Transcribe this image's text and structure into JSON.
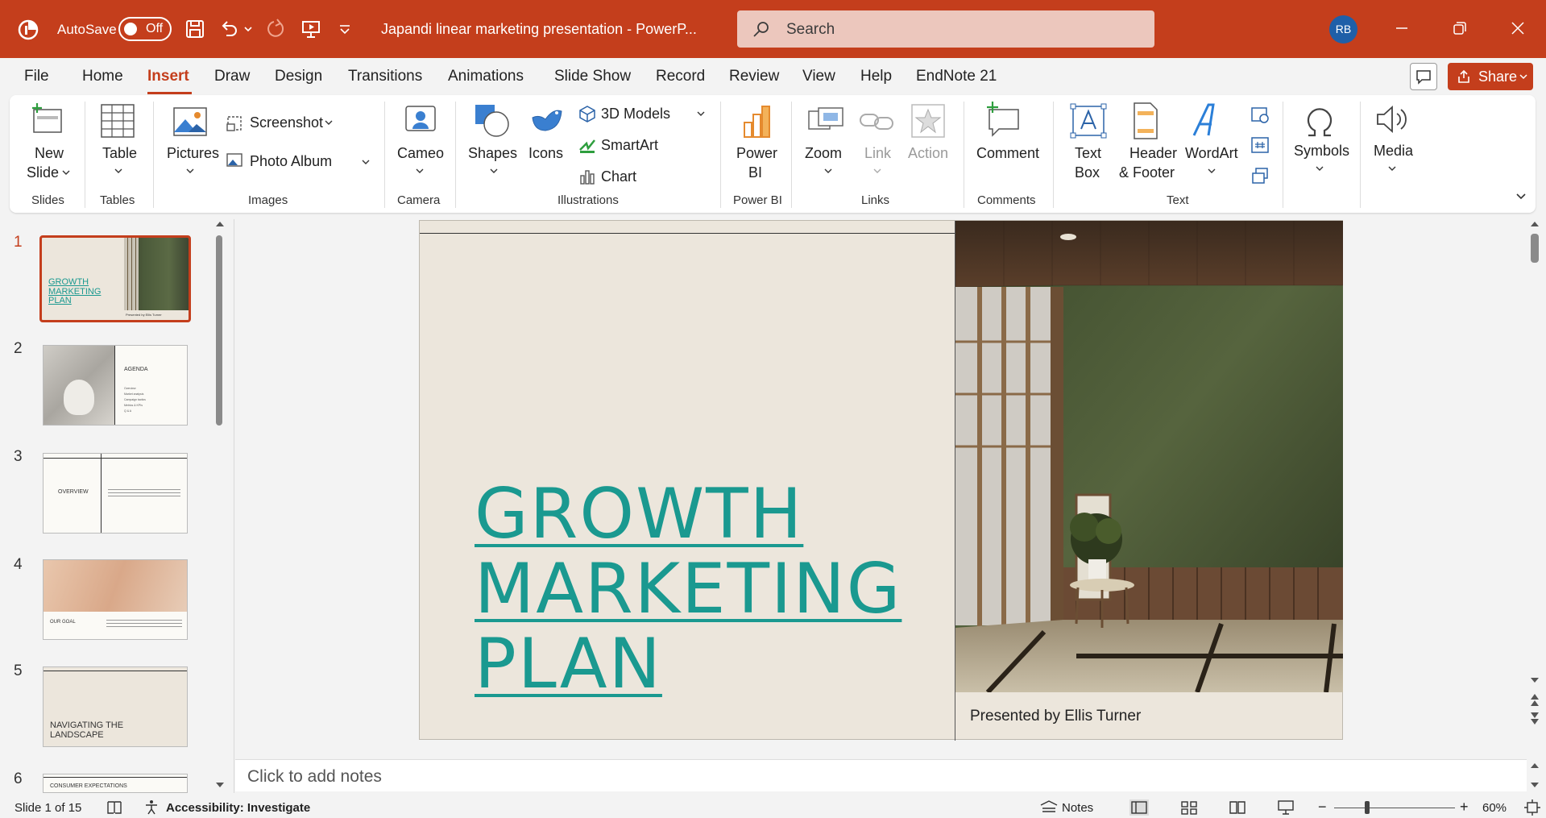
{
  "titlebar": {
    "autosave_label": "AutoSave",
    "autosave_state": "Off",
    "doc_title": "Japandi linear marketing presentation  -  PowerP...",
    "search_placeholder": "Search",
    "user_initials": "RB",
    "bg_color": "#c43e1c"
  },
  "menu": {
    "tabs": [
      "File",
      "Home",
      "Insert",
      "Draw",
      "Design",
      "Transitions",
      "Animations",
      "Slide Show",
      "Record",
      "Review",
      "View",
      "Help",
      "EndNote 21"
    ],
    "active_tab": "Insert",
    "share_label": "Share"
  },
  "ribbon": {
    "slides": {
      "new_slide_1": "New",
      "new_slide_2": "Slide",
      "group": "Slides"
    },
    "tables": {
      "table": "Table",
      "group": "Tables"
    },
    "images": {
      "pictures": "Pictures",
      "screenshot": "Screenshot",
      "photo_album": "Photo Album",
      "group": "Images"
    },
    "camera": {
      "cameo": "Cameo",
      "group": "Camera"
    },
    "illustrations": {
      "shapes": "Shapes",
      "icons": "Icons",
      "models": "3D Models",
      "smartart": "SmartArt",
      "chart": "Chart",
      "group": "Illustrations"
    },
    "powerbi": {
      "line1": "Power",
      "line2": "BI",
      "group": "Power BI"
    },
    "links": {
      "zoom": "Zoom",
      "link": "Link",
      "action": "Action",
      "group": "Links"
    },
    "comments": {
      "comment": "Comment",
      "group": "Comments"
    },
    "text": {
      "textbox_1": "Text",
      "textbox_2": "Box",
      "header_1": "Header",
      "header_2": "& Footer",
      "wordart": "WordArt",
      "group": "Text"
    },
    "symbols": {
      "symbols": "Symbols"
    },
    "media": {
      "media": "Media"
    }
  },
  "slides_panel": {
    "items": [
      {
        "num": "1",
        "title": "GROWTH MARKETING PLAN",
        "sub": "Presented by Ellis Turner"
      },
      {
        "num": "2",
        "title": "AGENDA",
        "lines": [
          "Overview",
          "Market analysis",
          "Campaign tactics",
          "Metrics & KPIs",
          "Q & A"
        ]
      },
      {
        "num": "3",
        "title": "OVERVIEW"
      },
      {
        "num": "4",
        "title": "OUR GOAL"
      },
      {
        "num": "5",
        "title": "NAVIGATING THE LANDSCAPE"
      },
      {
        "num": "6",
        "title": "CONSUMER EXPECTATIONS"
      }
    ]
  },
  "slide": {
    "title_lines": [
      "GROWTH",
      "MARKETING",
      "PLAN"
    ],
    "presenter": "Presented by Ellis Turner",
    "title_color": "#1a9990"
  },
  "notes": {
    "placeholder": "Click to add notes"
  },
  "status": {
    "slide_count": "Slide 1 of 15",
    "accessibility": "Accessibility: Investigate",
    "notes_label": "Notes",
    "zoom": "60%"
  }
}
